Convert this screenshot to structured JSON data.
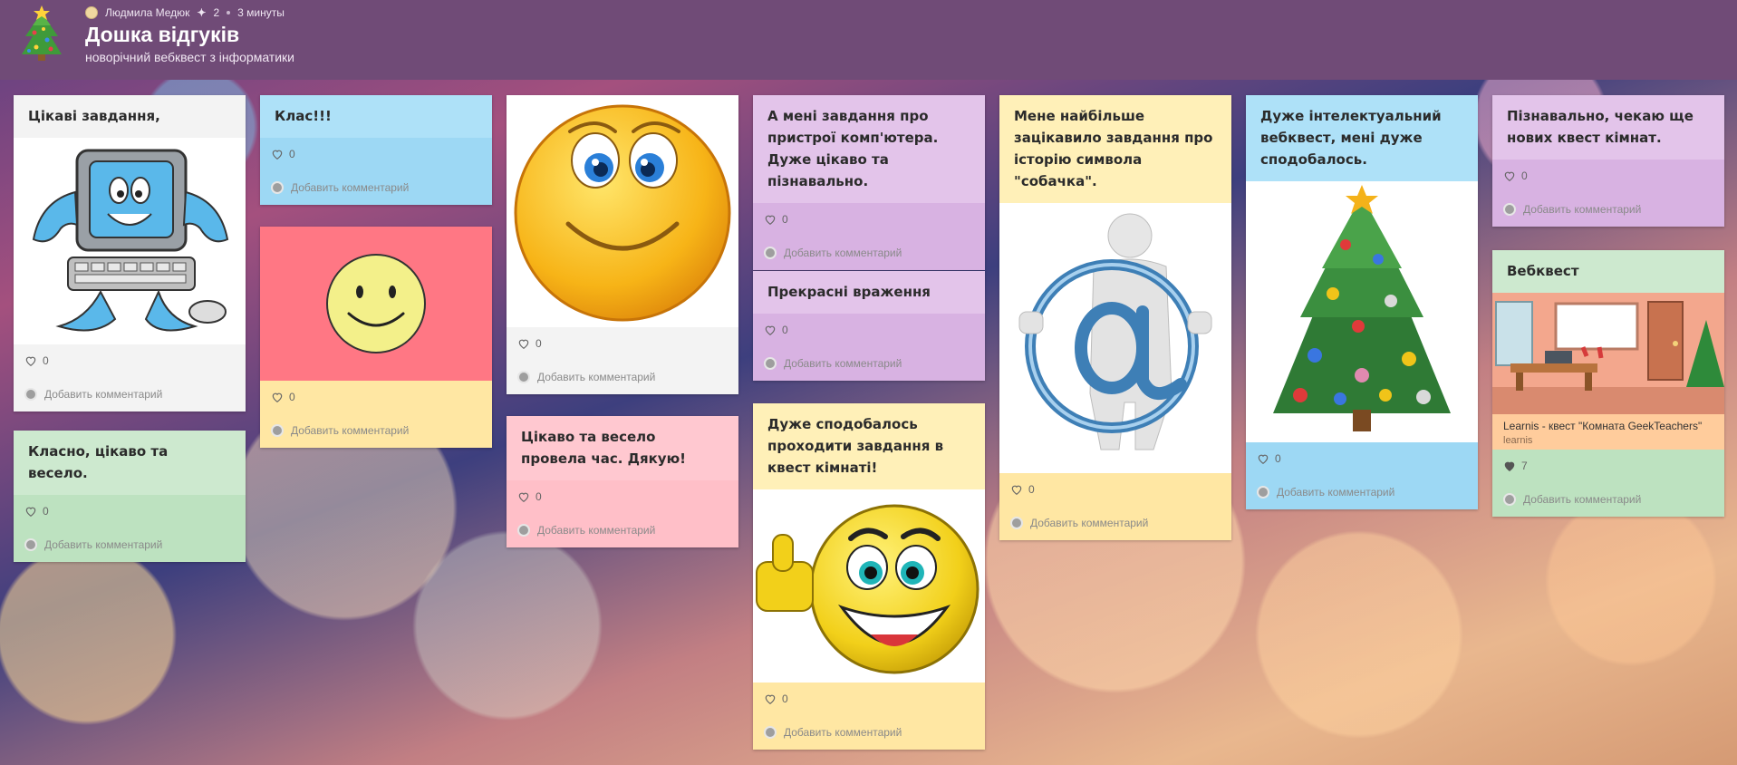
{
  "header": {
    "author": "Людмила Медюк",
    "contributors": "2",
    "time": "3 минуты",
    "title": "Дошка відгуків",
    "subtitle": "новорічний веб­квест з інформатики"
  },
  "comment_label": "Добавить комментарий",
  "cards": {
    "c1": {
      "title": "Цікаві завдання,",
      "likes": "0",
      "image": "computer-cartoon"
    },
    "c2": {
      "title": "Класно, цікаво та весело.",
      "likes": "0"
    },
    "c3": {
      "title": "Клас!!!",
      "likes": "0"
    },
    "c4": {
      "likes": "0",
      "image": "smiley-face",
      "color": "#ff7784"
    },
    "c5": {
      "likes": "0",
      "image": "smiling-emoji"
    },
    "c6": {
      "title": "Цікаво та весело провела час. Дякую!",
      "likes": "0"
    },
    "c7": {
      "title": "А мені завдання про пристрої комп'ютера. Дуже цікаво та пізнавально.",
      "likes": "0"
    },
    "c8": {
      "title": "Прекрасні враження",
      "likes": "0"
    },
    "c9": {
      "title": "Дуже сподобалось проходити завдання в квест кімнаті!",
      "likes": "0",
      "image": "thumbs-up-emoji"
    },
    "c10": {
      "title": "Мене найбільше зацікавило завдання про історію символа \"собачка\".",
      "likes": "0",
      "image": "at-sign-figure"
    },
    "c11": {
      "title": "Дуже інтелектуальний веб­квест, мені дуже сподобалось.",
      "likes": "0",
      "image": "christmas-tree"
    },
    "c12": {
      "title": "Пізнавально, чекаю ще нових квест кімнат.",
      "likes": "0"
    },
    "c13": {
      "title": "Веб­квест",
      "likes": "7",
      "link_title": "Learnis - квест \"Комната GeekTeachers\"",
      "link_domain": "learnis",
      "image": "room-scene"
    }
  },
  "colors": {
    "header": "#704b77",
    "accent": "#ff7784"
  }
}
